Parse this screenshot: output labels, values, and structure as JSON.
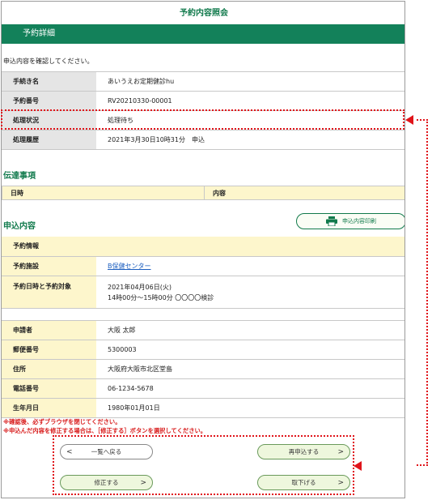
{
  "page": {
    "title": "予約内容照会",
    "section": "予約詳細",
    "intro": "申込内容を確認してください。"
  },
  "basic": [
    {
      "label": "手続き名",
      "value": "あいうえお定期健診hu"
    },
    {
      "label": "予約番号",
      "value": "RV20210330-00001"
    },
    {
      "label": "処理状況",
      "value": "処理待ち"
    },
    {
      "label": "処理履歴",
      "value": "2021年3月30日10時31分　申込"
    }
  ],
  "messages": {
    "heading": "伝達事項",
    "col_datetime": "日時",
    "col_content": "内容"
  },
  "application": {
    "heading": "申込内容",
    "print_label": "申込内容印刷",
    "info_heading": "予約情報",
    "facility_label": "予約施設",
    "facility_value": "B保健センター",
    "datetime_label": "予約日時と予約対象",
    "datetime_line1": "2021年04月06日(火)",
    "datetime_line2": "14時00分～15時00分 〇〇〇〇検診",
    "applicant_label": "申請者",
    "applicant_value": "大阪 太郎",
    "zip_label": "郵便番号",
    "zip_value": "5300003",
    "address_label": "住所",
    "address_value": "大阪府大阪市北区堂島",
    "phone_label": "電話番号",
    "phone_value": "06-1234-5678",
    "birth_label": "生年月日",
    "birth_value": "1980年01月01日"
  },
  "warnings": {
    "line1": "※確認後、必ずブラウザを閉じてください。",
    "line2": "※申込んだ内容を修正する場合は、［修正する］ボタンを選択してください。"
  },
  "buttons": {
    "back": "一覧へ戻る",
    "reapply": "再申込する",
    "edit": "修正する",
    "cancel": "取下げる"
  },
  "icons": {
    "print": "printer-icon"
  },
  "colors": {
    "brand_green": "#13815a",
    "highlight_red": "#e0141a",
    "header_yellow": "#fdf6cc"
  }
}
